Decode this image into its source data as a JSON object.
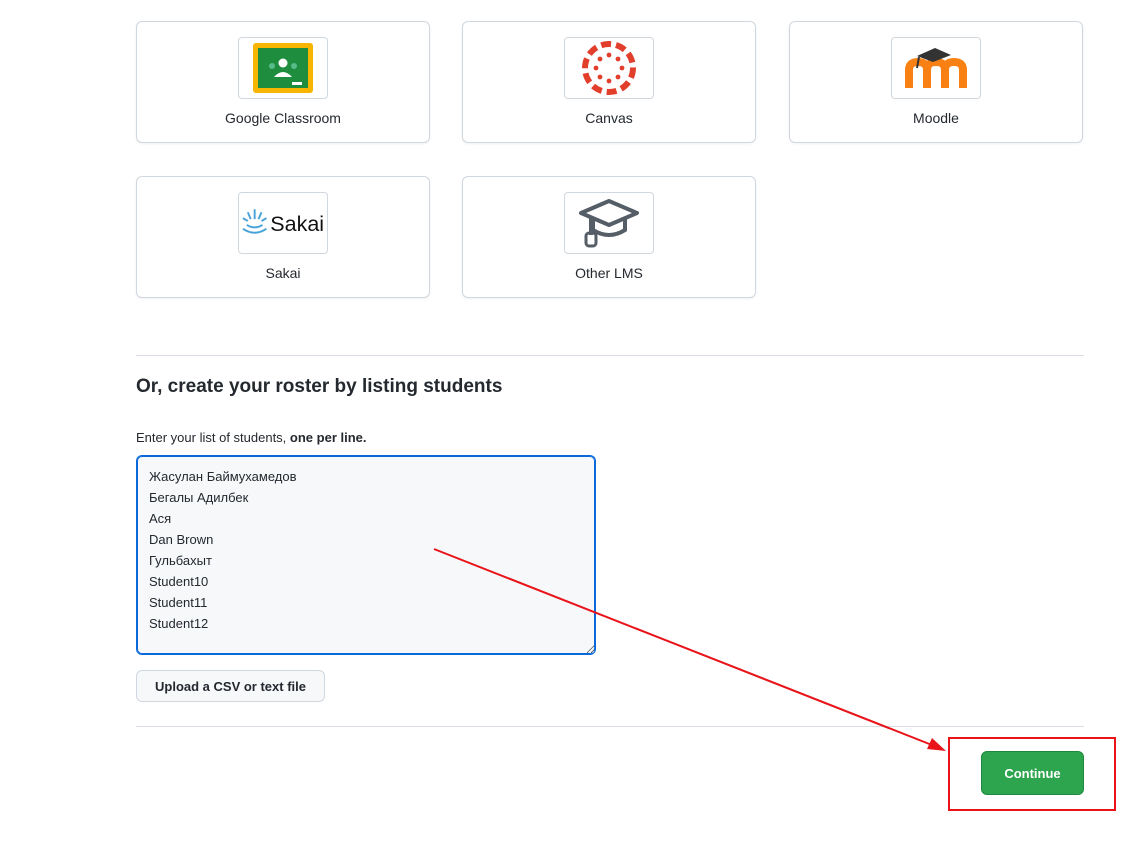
{
  "lms_options": [
    {
      "label": "Google Classroom",
      "icon": "google-classroom-logo"
    },
    {
      "label": "Canvas",
      "icon": "canvas-logo"
    },
    {
      "label": "Moodle",
      "icon": "moodle-logo"
    },
    {
      "label": "Sakai",
      "icon": "sakai-logo"
    },
    {
      "label": "Other LMS",
      "icon": "graduation-cap-icon"
    }
  ],
  "roster": {
    "heading": "Or, create your roster by listing students",
    "instruction_prefix": "Enter your list of students,",
    "instruction_bold": "one per line.",
    "students_text": "Жасулан Баймухамедов\nБегалы Адилбек\nАся\nDan Brown\nГульбахыт\nStudent10\nStudent11\nStudent12",
    "upload_label": "Upload a CSV or text file"
  },
  "footer": {
    "continue_label": "Continue"
  },
  "sakai_wordmark": "Sakai",
  "colors": {
    "primary_green": "#2da44e",
    "annotation_red": "#e8141a",
    "focus_blue": "#0969da",
    "canvas_red": "#e13f2b",
    "moodle_orange": "#f98012"
  }
}
